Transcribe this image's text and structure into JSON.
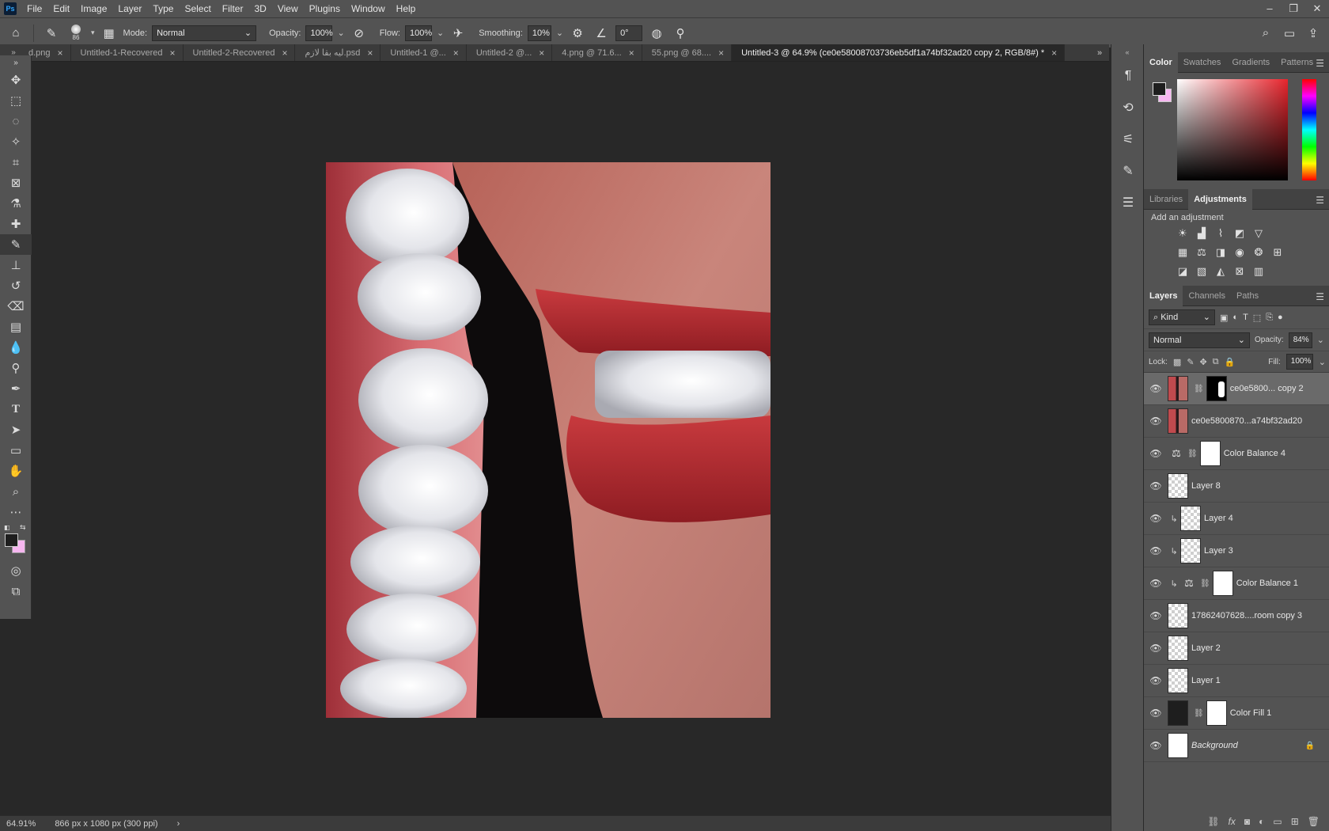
{
  "app": {
    "logo": "Ps"
  },
  "menu": [
    "File",
    "Edit",
    "Image",
    "Layer",
    "Type",
    "Select",
    "Filter",
    "3D",
    "View",
    "Plugins",
    "Window",
    "Help"
  ],
  "options": {
    "brush_size": "86",
    "mode_label": "Mode:",
    "mode_value": "Normal",
    "opacity_label": "Opacity:",
    "opacity_value": "100%",
    "flow_label": "Flow:",
    "flow_value": "100%",
    "smoothing_label": "Smoothing:",
    "smoothing_value": "10%",
    "angle_value": "0°"
  },
  "tabs": [
    {
      "label": "d.png",
      "close": "×"
    },
    {
      "label": "Untitled-1-Recovered",
      "close": "×"
    },
    {
      "label": "Untitled-2-Recovered",
      "close": "×"
    },
    {
      "label": "ليه بقا لازم.psd",
      "close": "×"
    },
    {
      "label": "Untitled-1 @...",
      "close": "×"
    },
    {
      "label": "Untitled-2 @...",
      "close": "×"
    },
    {
      "label": "4.png @ 71.6...",
      "close": "×"
    },
    {
      "label": "55.png @ 68....",
      "close": "×"
    },
    {
      "label": "Untitled-3 @ 64.9% (ce0e58008703736eb5df1a74bf32ad20 copy 2, RGB/8#) *",
      "close": "×"
    }
  ],
  "status": {
    "zoom": "64.91%",
    "info": "866 px x 1080 px (300 ppi)",
    "arrow": "›"
  },
  "color_panel": {
    "tabs": [
      "Color",
      "Swatches",
      "Gradients",
      "Patterns"
    ],
    "foreground": "#1e1e1e",
    "background": "#f6b6f0"
  },
  "adjustments_panel": {
    "tabs": [
      "Libraries",
      "Adjustments"
    ],
    "title": "Add an adjustment"
  },
  "layers_panel": {
    "tabs": [
      "Layers",
      "Channels",
      "Paths"
    ],
    "kind_label": "Kind",
    "blend_mode": "Normal",
    "opacity_label": "Opacity:",
    "opacity_value": "84%",
    "lock_label": "Lock:",
    "fill_label": "Fill:",
    "fill_value": "100%",
    "layers": [
      {
        "name": "ce0e5800... copy 2",
        "thumb": "photo",
        "mask": true,
        "selected": true
      },
      {
        "name": "ce0e5800870...a74bf32ad20",
        "thumb": "photo"
      },
      {
        "name": "Color Balance 4",
        "adjustment": true
      },
      {
        "name": "Layer 8",
        "thumb": "trans"
      },
      {
        "name": "Layer 4",
        "thumb": "trans",
        "clipped": true
      },
      {
        "name": "Layer 3",
        "thumb": "trans",
        "clipped": true
      },
      {
        "name": "Color Balance 1",
        "adjustment": true,
        "clipped": true
      },
      {
        "name": "17862407628....room copy 3",
        "thumb": "trans"
      },
      {
        "name": "Layer 2",
        "thumb": "trans"
      },
      {
        "name": "Layer 1",
        "thumb": "trans"
      },
      {
        "name": "Color Fill 1",
        "thumb": "dark",
        "mask": "white"
      },
      {
        "name": "Background",
        "thumb": "white",
        "locked": true
      }
    ]
  }
}
